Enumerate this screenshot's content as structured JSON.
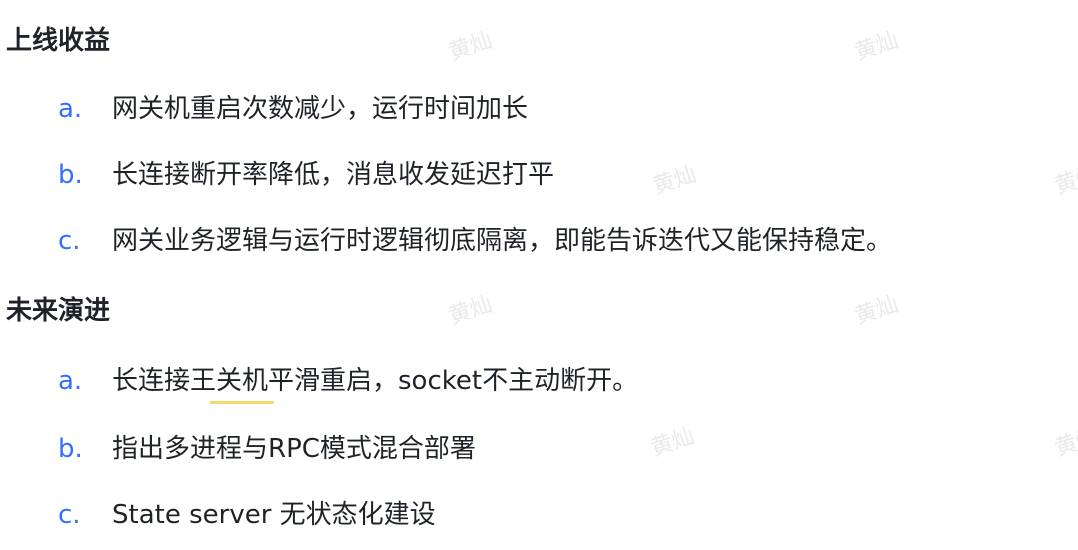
{
  "sections": [
    {
      "heading": "上线收益",
      "items": [
        {
          "marker": "a.",
          "text": "网关机重启次数减少，运行时间加长"
        },
        {
          "marker": "b.",
          "text": "长连接断开率降低，消息收发延迟打平"
        },
        {
          "marker": "c.",
          "text": "网关业务逻辑与运行时逻辑彻底隔离，即能告诉迭代又能保持稳定。"
        }
      ]
    },
    {
      "heading": "未来演进",
      "items": [
        {
          "marker": "a.",
          "text": "长连接王关机平滑重启，socket不主动断开。"
        },
        {
          "marker": "b.",
          "text": "指出多进程与RPC模式混合部署"
        },
        {
          "marker": "c.",
          "text": "State server 无状态化建设"
        }
      ]
    }
  ],
  "watermark": "黄灿",
  "colors": {
    "list_marker": "#3370ff",
    "text": "#1f2329",
    "highlight_underline": "#f5d96b"
  }
}
